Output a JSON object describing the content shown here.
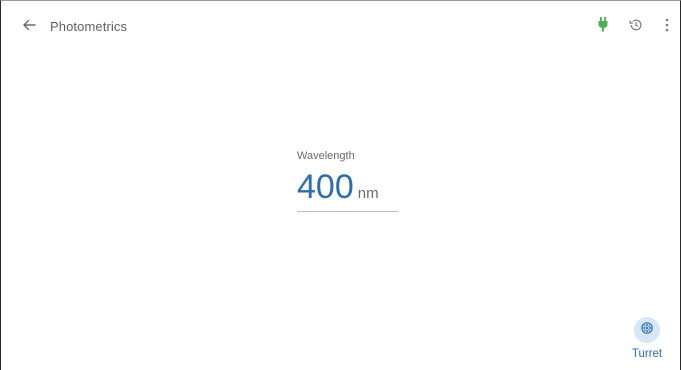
{
  "header": {
    "title": "Photometrics",
    "back_icon": "arrow-left-icon",
    "actions": [
      {
        "name": "plug-icon",
        "color": "#4caf50"
      },
      {
        "name": "history-icon",
        "color": "#7a7a7a"
      },
      {
        "name": "more-vert-icon",
        "color": "#7a7a7a"
      }
    ]
  },
  "wavelength": {
    "label": "Wavelength",
    "value": "400",
    "unit": "nm"
  },
  "turret": {
    "label": "Turret",
    "icon": "turret-icon"
  },
  "colors": {
    "accent": "#2d6eb0",
    "accent_light": "#d8e7f6",
    "plug_green": "#4caf50"
  }
}
